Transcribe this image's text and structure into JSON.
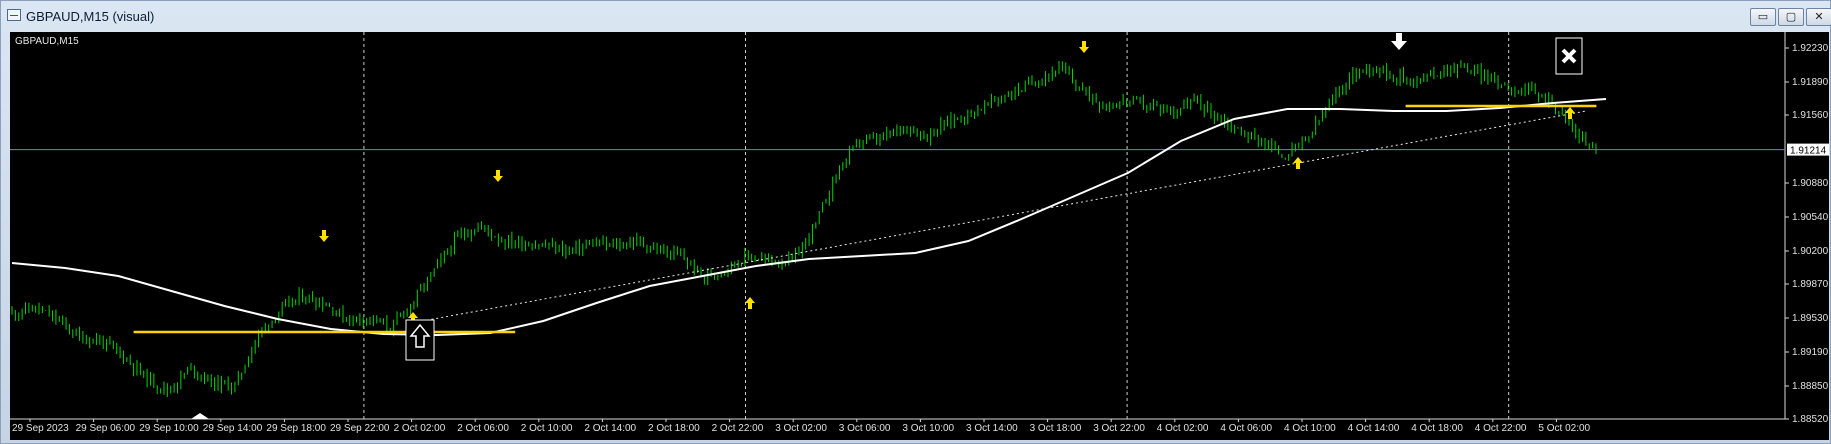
{
  "window": {
    "title": "GBPAUD,M15 (visual)",
    "controls": {
      "minimize": "▭",
      "restore": "▢",
      "close": "✕"
    }
  },
  "chart": {
    "symbol_label": "GBPAUD,M15",
    "current_price": "1.91214",
    "colors": {
      "background": "#000000",
      "candles": "#00d400",
      "moving_average": "#ffffff",
      "support_line": "#ffd200",
      "arrows": "#ffe000"
    },
    "icons": [
      "arrow-up-icon",
      "arrow-down-icon",
      "buy-signal-icon",
      "close-trade-icon"
    ]
  },
  "chart_data": {
    "type": "line",
    "series": [
      {
        "values": [
          1.8958,
          1.8963,
          1.8952,
          1.8934,
          1.893,
          1.8915,
          1.8893,
          1.888,
          1.8903,
          1.8888,
          1.8885,
          1.8935,
          1.896,
          1.8975,
          1.8968,
          1.8952,
          1.8953,
          1.8943,
          1.897,
          1.9003,
          1.9035,
          1.9045,
          1.903,
          1.9028,
          1.9025,
          1.902,
          1.9028,
          1.9025,
          1.903,
          1.902,
          1.9015,
          1.8993,
          1.9003,
          1.9015,
          1.901,
          1.901,
          1.9045,
          1.91,
          1.913,
          1.9132,
          1.9145,
          1.9135,
          1.915,
          1.9158,
          1.917,
          1.918,
          1.9192,
          1.9203,
          1.918,
          1.9165,
          1.917,
          1.9165,
          1.916,
          1.917,
          1.9155,
          1.914,
          1.913,
          1.9115,
          1.913,
          1.9165,
          1.9195,
          1.9205,
          1.9195,
          1.919,
          1.92,
          1.9205,
          1.9195,
          1.9185,
          1.918,
          1.917,
          1.914,
          1.9121
        ]
      }
    ],
    "x_tick_labels": [
      "29 Sep 2023",
      "29 Sep 06:00",
      "29 Sep 10:00",
      "29 Sep 14:00",
      "29 Sep 18:00",
      "29 Sep 22:00",
      "2 Oct 02:00",
      "2 Oct 06:00",
      "2 Oct 10:00",
      "2 Oct 14:00",
      "2 Oct 18:00",
      "2 Oct 22:00",
      "3 Oct 02:00",
      "3 Oct 06:00",
      "3 Oct 10:00",
      "3 Oct 14:00",
      "3 Oct 18:00",
      "3 Oct 22:00",
      "4 Oct 02:00",
      "4 Oct 06:00",
      "4 Oct 10:00",
      "4 Oct 14:00",
      "4 Oct 18:00",
      "4 Oct 22:00",
      "5 Oct 02:00"
    ],
    "y_tick_labels": [
      "1.92230",
      "1.91890",
      "1.91560",
      "1.90880",
      "1.90540",
      "1.90200",
      "1.89870",
      "1.89530",
      "1.89190",
      "1.88850",
      "1.88520"
    ],
    "ylim": [
      1.8852,
      1.9237
    ],
    "current_price": 1.91214,
    "moving_average": [
      1.9008,
      1.9003,
      1.8995,
      1.898,
      1.8965,
      1.8952,
      1.8942,
      1.8937,
      1.8936,
      1.8938,
      1.895,
      1.8968,
      1.8985,
      1.8995,
      1.9005,
      1.9012,
      1.9015,
      1.9018,
      1.903,
      1.9052,
      1.9075,
      1.9098,
      1.913,
      1.9152,
      1.9162,
      1.9162,
      1.916,
      1.916,
      1.9163,
      1.9168,
      1.9172
    ],
    "support_lines": [
      {
        "y": 1.8939,
        "from": "29 Sep 06:00",
        "to": "2 Oct 06:00"
      },
      {
        "y": 1.9165,
        "from": "4 Oct 14:00",
        "to": "5 Oct 02:00"
      }
    ],
    "trendline": {
      "from": [
        1.8949,
        "2 Oct 02:00"
      ],
      "to": [
        1.916,
        "5 Oct 02:00"
      ]
    },
    "grid": true,
    "grid_style": "vertical dashed"
  }
}
